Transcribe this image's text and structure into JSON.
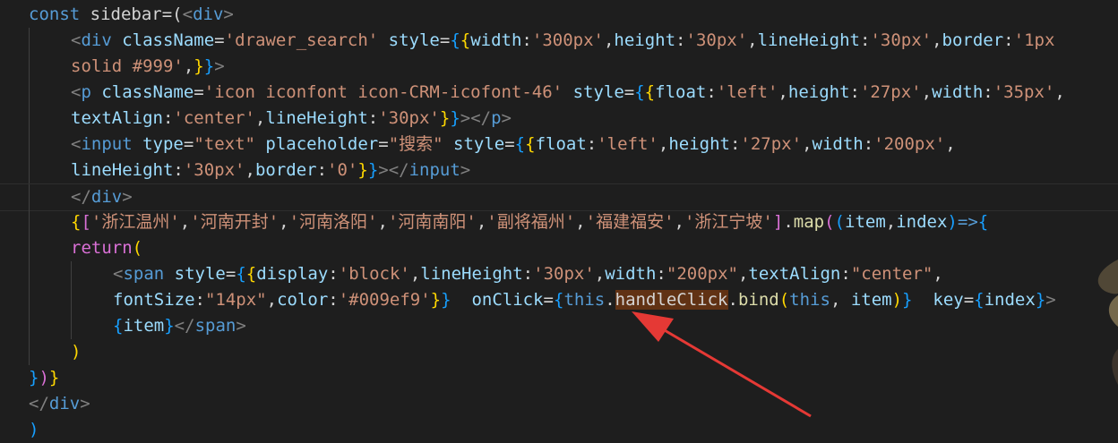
{
  "editor": {
    "lines": [
      {
        "indent": 0,
        "guides": 0,
        "tokens": [
          {
            "t": "const ",
            "c": "kw"
          },
          {
            "t": "sidebar",
            "c": "plain"
          },
          {
            "t": "=(",
            "c": "op"
          },
          {
            "t": "<",
            "c": "punct"
          },
          {
            "t": "div",
            "c": "tag"
          },
          {
            "t": ">",
            "c": "punct"
          }
        ]
      },
      {
        "indent": 1,
        "guides": 1,
        "tokens": [
          {
            "t": "<",
            "c": "punct"
          },
          {
            "t": "div ",
            "c": "tag"
          },
          {
            "t": "className",
            "c": "attr"
          },
          {
            "t": "=",
            "c": "op"
          },
          {
            "t": "'drawer_search'",
            "c": "str"
          },
          {
            "t": " style",
            "c": "attr"
          },
          {
            "t": "=",
            "c": "op"
          },
          {
            "t": "{",
            "c": "brace3"
          },
          {
            "t": "{",
            "c": "brace1"
          },
          {
            "t": "width",
            "c": "attr"
          },
          {
            "t": ":",
            "c": "op"
          },
          {
            "t": "'300px'",
            "c": "str"
          },
          {
            "t": ",",
            "c": "op"
          },
          {
            "t": "height",
            "c": "attr"
          },
          {
            "t": ":",
            "c": "op"
          },
          {
            "t": "'30px'",
            "c": "str"
          },
          {
            "t": ",",
            "c": "op"
          },
          {
            "t": "lineHeight",
            "c": "attr"
          },
          {
            "t": ":",
            "c": "op"
          },
          {
            "t": "'30px'",
            "c": "str"
          },
          {
            "t": ",",
            "c": "op"
          },
          {
            "t": "border",
            "c": "attr"
          },
          {
            "t": ":",
            "c": "op"
          },
          {
            "t": "'1px",
            "c": "str"
          }
        ]
      },
      {
        "indent": 1,
        "guides": 1,
        "tokens": [
          {
            "t": "solid #999'",
            "c": "str"
          },
          {
            "t": ",",
            "c": "op"
          },
          {
            "t": "}",
            "c": "brace1"
          },
          {
            "t": "}",
            "c": "brace3"
          },
          {
            "t": ">",
            "c": "punct"
          }
        ]
      },
      {
        "indent": 1,
        "guides": 1,
        "tokens": [
          {
            "t": "<",
            "c": "punct"
          },
          {
            "t": "p ",
            "c": "tag"
          },
          {
            "t": "className",
            "c": "attr"
          },
          {
            "t": "=",
            "c": "op"
          },
          {
            "t": "'icon iconfont icon-CRM-icofont-46'",
            "c": "str"
          },
          {
            "t": " style",
            "c": "attr"
          },
          {
            "t": "=",
            "c": "op"
          },
          {
            "t": "{",
            "c": "brace3"
          },
          {
            "t": "{",
            "c": "brace1"
          },
          {
            "t": "float",
            "c": "attr"
          },
          {
            "t": ":",
            "c": "op"
          },
          {
            "t": "'left'",
            "c": "str"
          },
          {
            "t": ",",
            "c": "op"
          },
          {
            "t": "height",
            "c": "attr"
          },
          {
            "t": ":",
            "c": "op"
          },
          {
            "t": "'27px'",
            "c": "str"
          },
          {
            "t": ",",
            "c": "op"
          },
          {
            "t": "width",
            "c": "attr"
          },
          {
            "t": ":",
            "c": "op"
          },
          {
            "t": "'35px'",
            "c": "str"
          },
          {
            "t": ",",
            "c": "op"
          }
        ]
      },
      {
        "indent": 1,
        "guides": 1,
        "tokens": [
          {
            "t": "textAlign",
            "c": "attr"
          },
          {
            "t": ":",
            "c": "op"
          },
          {
            "t": "'center'",
            "c": "str"
          },
          {
            "t": ",",
            "c": "op"
          },
          {
            "t": "lineHeight",
            "c": "attr"
          },
          {
            "t": ":",
            "c": "op"
          },
          {
            "t": "'30px'",
            "c": "str"
          },
          {
            "t": "}",
            "c": "brace1"
          },
          {
            "t": "}",
            "c": "brace3"
          },
          {
            "t": "></",
            "c": "punct"
          },
          {
            "t": "p",
            "c": "tag"
          },
          {
            "t": ">",
            "c": "punct"
          }
        ]
      },
      {
        "indent": 1,
        "guides": 1,
        "tokens": [
          {
            "t": "<",
            "c": "punct"
          },
          {
            "t": "input ",
            "c": "tag"
          },
          {
            "t": "type",
            "c": "attr"
          },
          {
            "t": "=",
            "c": "op"
          },
          {
            "t": "\"text\"",
            "c": "str"
          },
          {
            "t": " placeholder",
            "c": "attr"
          },
          {
            "t": "=",
            "c": "op"
          },
          {
            "t": "\"搜索\"",
            "c": "str"
          },
          {
            "t": " style",
            "c": "attr"
          },
          {
            "t": "=",
            "c": "op"
          },
          {
            "t": "{",
            "c": "brace3"
          },
          {
            "t": "{",
            "c": "brace1"
          },
          {
            "t": "float",
            "c": "attr"
          },
          {
            "t": ":",
            "c": "op"
          },
          {
            "t": "'left'",
            "c": "str"
          },
          {
            "t": ",",
            "c": "op"
          },
          {
            "t": "height",
            "c": "attr"
          },
          {
            "t": ":",
            "c": "op"
          },
          {
            "t": "'27px'",
            "c": "str"
          },
          {
            "t": ",",
            "c": "op"
          },
          {
            "t": "width",
            "c": "attr"
          },
          {
            "t": ":",
            "c": "op"
          },
          {
            "t": "'200px'",
            "c": "str"
          },
          {
            "t": ",",
            "c": "op"
          }
        ]
      },
      {
        "indent": 1,
        "guides": 1,
        "tokens": [
          {
            "t": "lineHeight",
            "c": "attr"
          },
          {
            "t": ":",
            "c": "op"
          },
          {
            "t": "'30px'",
            "c": "str"
          },
          {
            "t": ",",
            "c": "op"
          },
          {
            "t": "border",
            "c": "attr"
          },
          {
            "t": ":",
            "c": "op"
          },
          {
            "t": "'0'",
            "c": "str"
          },
          {
            "t": "}",
            "c": "brace1"
          },
          {
            "t": "}",
            "c": "brace3"
          },
          {
            "t": "></",
            "c": "punct"
          },
          {
            "t": "input",
            "c": "tag"
          },
          {
            "t": ">",
            "c": "punct"
          }
        ]
      },
      {
        "indent": 1,
        "guides": 1,
        "current": true,
        "tokens": [
          {
            "t": "</",
            "c": "punct"
          },
          {
            "t": "div",
            "c": "tag"
          },
          {
            "t": ">",
            "c": "punct"
          }
        ]
      },
      {
        "indent": 1,
        "guides": 1,
        "tokens": [
          {
            "t": "{",
            "c": "brace1"
          },
          {
            "t": "[",
            "c": "brace2"
          },
          {
            "t": "'浙江温州'",
            "c": "str"
          },
          {
            "t": ",",
            "c": "op"
          },
          {
            "t": "'河南开封'",
            "c": "str"
          },
          {
            "t": ",",
            "c": "op"
          },
          {
            "t": "'河南洛阳'",
            "c": "str"
          },
          {
            "t": ",",
            "c": "op"
          },
          {
            "t": "'河南南阳'",
            "c": "str"
          },
          {
            "t": ",",
            "c": "op"
          },
          {
            "t": "'副将福州'",
            "c": "str"
          },
          {
            "t": ",",
            "c": "op"
          },
          {
            "t": "'福建福安'",
            "c": "str"
          },
          {
            "t": ",",
            "c": "op"
          },
          {
            "t": "'浙江宁坡'",
            "c": "str"
          },
          {
            "t": "]",
            "c": "brace2"
          },
          {
            "t": ".",
            "c": "op"
          },
          {
            "t": "map",
            "c": "fn"
          },
          {
            "t": "(",
            "c": "brace2"
          },
          {
            "t": "(",
            "c": "brace3"
          },
          {
            "t": "item",
            "c": "var"
          },
          {
            "t": ",",
            "c": "op"
          },
          {
            "t": "index",
            "c": "var"
          },
          {
            "t": ")",
            "c": "brace3"
          },
          {
            "t": "=>",
            "c": "kw"
          },
          {
            "t": "{",
            "c": "brace3"
          }
        ]
      },
      {
        "indent": 1,
        "guides": 1,
        "tokens": [
          {
            "t": "return",
            "c": "brace2"
          },
          {
            "t": "(",
            "c": "brace1"
          }
        ]
      },
      {
        "indent": 2,
        "guides": 2,
        "tokens": [
          {
            "t": "<",
            "c": "punct"
          },
          {
            "t": "span ",
            "c": "tag"
          },
          {
            "t": "style",
            "c": "attr"
          },
          {
            "t": "=",
            "c": "op"
          },
          {
            "t": "{",
            "c": "brace3"
          },
          {
            "t": "{",
            "c": "brace1"
          },
          {
            "t": "display",
            "c": "attr"
          },
          {
            "t": ":",
            "c": "op"
          },
          {
            "t": "'block'",
            "c": "str"
          },
          {
            "t": ",",
            "c": "op"
          },
          {
            "t": "lineHeight",
            "c": "attr"
          },
          {
            "t": ":",
            "c": "op"
          },
          {
            "t": "'30px'",
            "c": "str"
          },
          {
            "t": ",",
            "c": "op"
          },
          {
            "t": "width",
            "c": "attr"
          },
          {
            "t": ":",
            "c": "op"
          },
          {
            "t": "\"200px\"",
            "c": "str"
          },
          {
            "t": ",",
            "c": "op"
          },
          {
            "t": "textAlign",
            "c": "attr"
          },
          {
            "t": ":",
            "c": "op"
          },
          {
            "t": "\"center\"",
            "c": "str"
          },
          {
            "t": ",",
            "c": "op"
          }
        ]
      },
      {
        "indent": 2,
        "guides": 2,
        "tokens": [
          {
            "t": "fontSize",
            "c": "attr"
          },
          {
            "t": ":",
            "c": "op"
          },
          {
            "t": "\"14px\"",
            "c": "str"
          },
          {
            "t": ",",
            "c": "op"
          },
          {
            "t": "color",
            "c": "attr"
          },
          {
            "t": ":",
            "c": "op"
          },
          {
            "t": "'#009ef9'",
            "c": "str"
          },
          {
            "t": "}",
            "c": "brace1"
          },
          {
            "t": "}",
            "c": "brace3"
          },
          {
            "t": "  onClick",
            "c": "attr"
          },
          {
            "t": "=",
            "c": "op"
          },
          {
            "t": "{",
            "c": "brace3"
          },
          {
            "t": "this",
            "c": "kw"
          },
          {
            "t": ".",
            "c": "op"
          },
          {
            "t": "handleClick",
            "c": "find"
          },
          {
            "t": ".",
            "c": "op"
          },
          {
            "t": "bind",
            "c": "fn"
          },
          {
            "t": "(",
            "c": "brace1"
          },
          {
            "t": "this",
            "c": "kw"
          },
          {
            "t": ", ",
            "c": "op"
          },
          {
            "t": "item",
            "c": "var"
          },
          {
            "t": ")",
            "c": "brace1"
          },
          {
            "t": "}",
            "c": "brace3"
          },
          {
            "t": "  key",
            "c": "attr"
          },
          {
            "t": "=",
            "c": "op"
          },
          {
            "t": "{",
            "c": "brace3"
          },
          {
            "t": "index",
            "c": "var"
          },
          {
            "t": "}",
            "c": "brace3"
          },
          {
            "t": ">",
            "c": "punct"
          }
        ]
      },
      {
        "indent": 2,
        "guides": 2,
        "tokens": [
          {
            "t": "{",
            "c": "brace3"
          },
          {
            "t": "item",
            "c": "var"
          },
          {
            "t": "}",
            "c": "brace3"
          },
          {
            "t": "</",
            "c": "punct"
          },
          {
            "t": "span",
            "c": "tag"
          },
          {
            "t": ">",
            "c": "punct"
          }
        ]
      },
      {
        "indent": 1,
        "guides": 1,
        "tokens": [
          {
            "t": ")",
            "c": "brace1"
          }
        ]
      },
      {
        "indent": 0,
        "guides": 0,
        "tokens": [
          {
            "t": "}",
            "c": "brace3"
          },
          {
            "t": ")",
            "c": "brace2"
          },
          {
            "t": "}",
            "c": "brace1"
          }
        ]
      },
      {
        "indent": 0,
        "guides": 0,
        "tokens": [
          {
            "t": "</",
            "c": "punct"
          },
          {
            "t": "div",
            "c": "tag"
          },
          {
            "t": ">",
            "c": "punct"
          }
        ]
      },
      {
        "indent": 0,
        "guides": 0,
        "tokens": [
          {
            "t": ")",
            "c": "brace3"
          }
        ]
      }
    ]
  },
  "annotation": {
    "arrow_color": "#e53935",
    "target": "handleClick"
  }
}
